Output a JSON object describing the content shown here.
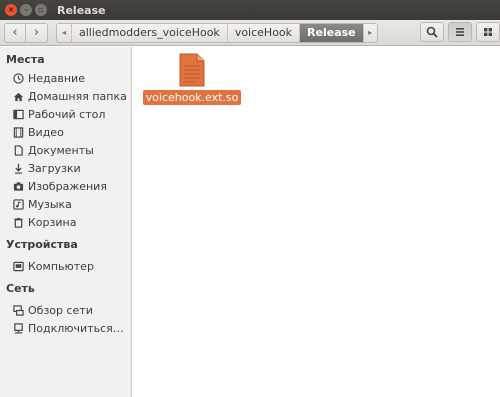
{
  "window": {
    "title": "Release"
  },
  "toolbar": {
    "breadcrumbs": [
      "alliedmodders_voiceHook",
      "voiceHook",
      "Release"
    ]
  },
  "sidebar": {
    "places_header": "Места",
    "places": [
      {
        "label": "Недавние",
        "icon": "clock-icon"
      },
      {
        "label": "Домашняя папка",
        "icon": "home-icon"
      },
      {
        "label": "Рабочий стол",
        "icon": "desktop-icon"
      },
      {
        "label": "Видео",
        "icon": "video-icon"
      },
      {
        "label": "Документы",
        "icon": "document-icon"
      },
      {
        "label": "Загрузки",
        "icon": "download-icon"
      },
      {
        "label": "Изображения",
        "icon": "camera-icon"
      },
      {
        "label": "Музыка",
        "icon": "music-icon"
      },
      {
        "label": "Корзина",
        "icon": "trash-icon"
      }
    ],
    "devices_header": "Устройства",
    "devices": [
      {
        "label": "Компьютер",
        "icon": "drive-icon"
      }
    ],
    "network_header": "Сеть",
    "network": [
      {
        "label": "Обзор сети",
        "icon": "network-icon"
      },
      {
        "label": "Подключиться…",
        "icon": "server-icon"
      }
    ]
  },
  "files": [
    {
      "name": "voicehook.ext.so",
      "selected": true,
      "icon": "shared-library-file-icon"
    }
  ],
  "colors": {
    "selection": "#e2733f",
    "titlebar": "#3c3b37",
    "close": "#e9552c"
  }
}
